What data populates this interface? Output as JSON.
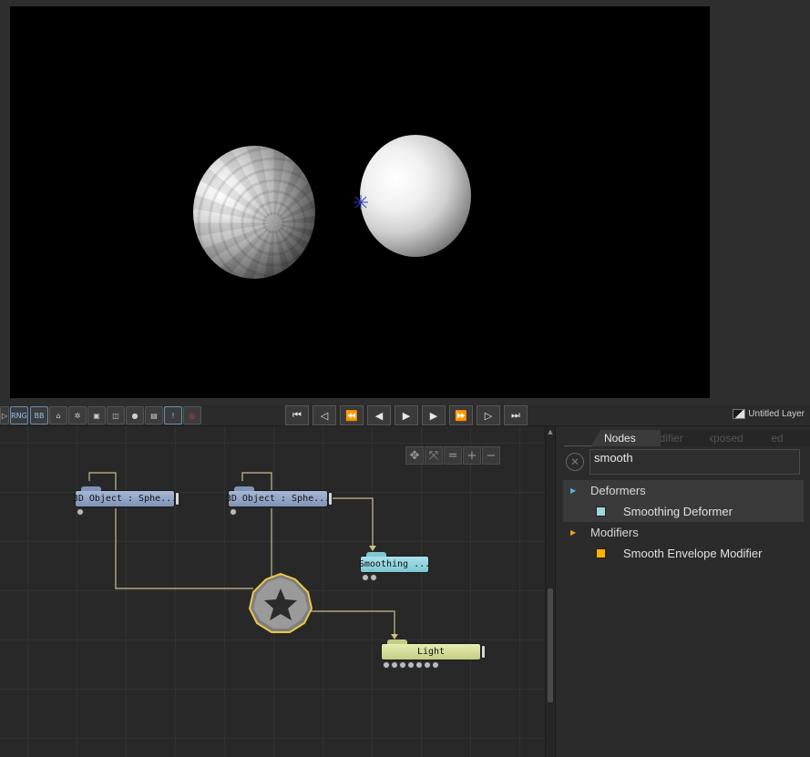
{
  "colors": {
    "deformer_arrow": "#4fb8d8",
    "modifier_arrow": "#f0a020",
    "deformer_swatch": "#9fd6e2",
    "modifier_swatch": "#ffb300",
    "wire": "#c9bd8a",
    "root_node_border": "#e8c84a"
  },
  "toolbar": {
    "left_buttons": [
      {
        "icon": "play-arrow-icon",
        "label": "▷"
      },
      {
        "icon": "rng-icon",
        "label": "RNG"
      },
      {
        "icon": "bb-icon",
        "label": "BB"
      },
      {
        "icon": "tree-icon",
        "label": "⌂"
      },
      {
        "icon": "star-icon",
        "label": "✲"
      },
      {
        "icon": "cube-icon",
        "label": "▣"
      },
      {
        "icon": "vr-goggles-icon",
        "label": "◫"
      },
      {
        "icon": "sphere-icon",
        "label": "●"
      },
      {
        "icon": "window-icon",
        "label": "▤"
      },
      {
        "icon": "alert-icon",
        "label": "!"
      },
      {
        "icon": "record-icon",
        "label": "◎"
      }
    ],
    "playback": [
      {
        "icon": "skip-to-start-icon",
        "label": "⏮"
      },
      {
        "icon": "prev-keyframe-icon",
        "label": "◁"
      },
      {
        "icon": "rewind-icon",
        "label": "⏪"
      },
      {
        "icon": "step-back-icon",
        "label": "◀"
      },
      {
        "icon": "play-icon",
        "label": "▶"
      },
      {
        "icon": "step-forward-icon",
        "label": "▶"
      },
      {
        "icon": "fast-forward-icon",
        "label": "⏩"
      },
      {
        "icon": "next-keyframe-icon",
        "label": "▷"
      },
      {
        "icon": "skip-to-end-icon",
        "label": "⏭"
      }
    ],
    "layer_name": "Untitled Layer"
  },
  "graph_tools": [
    {
      "icon": "move-icon",
      "label": "✥"
    },
    {
      "icon": "fit-icon",
      "label": "⤧"
    },
    {
      "icon": "align-icon",
      "label": "="
    },
    {
      "icon": "zoom-in-icon",
      "label": "+"
    },
    {
      "icon": "zoom-out-icon",
      "label": "−"
    }
  ],
  "nodes": {
    "object1": {
      "label": "3D  Object  :  Sphe..."
    },
    "object2": {
      "label": "3D  Object  :  Sphe..."
    },
    "smoothing": {
      "label": "Smoothing  ..."
    },
    "light": {
      "label": "Light"
    }
  },
  "panel": {
    "tabs": [
      "Nodes",
      "Modifier",
      "Exposed",
      "Exposed"
    ],
    "search_value": "smooth",
    "categories": [
      {
        "name": "Deformers",
        "items": [
          {
            "label": "Smoothing Deformer"
          }
        ]
      },
      {
        "name": "Modifiers",
        "items": [
          {
            "label": "Smooth Envelope Modifier"
          }
        ]
      }
    ]
  }
}
